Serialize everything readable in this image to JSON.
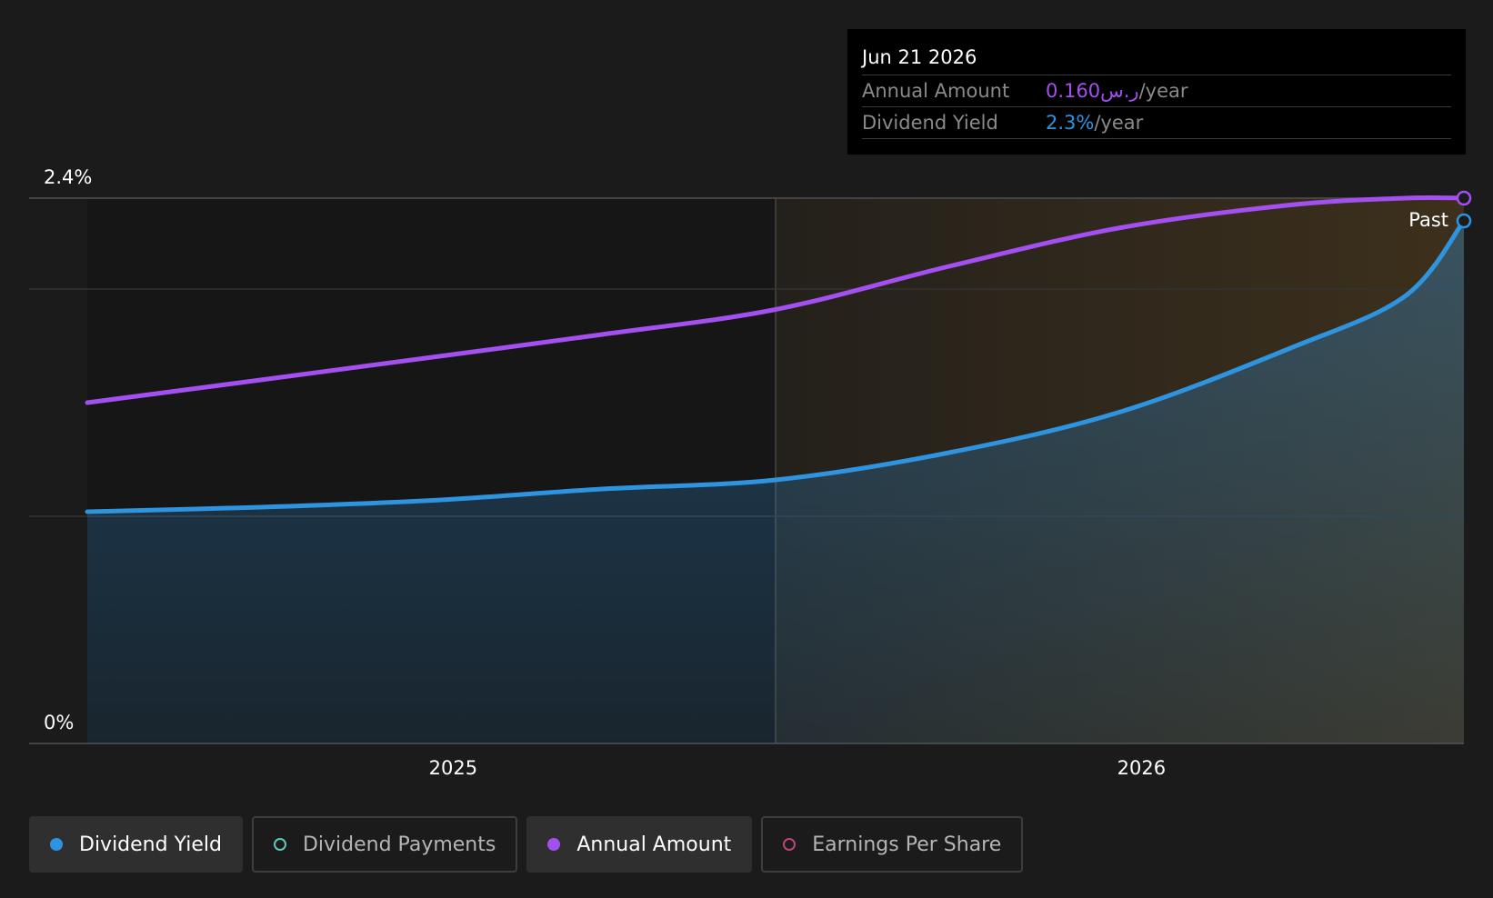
{
  "tooltip": {
    "date": "Jun 21 2026",
    "rows": [
      {
        "label": "Annual Amount",
        "value": "0.160ر.س",
        "suffix": "/year",
        "color": "#a44ff0"
      },
      {
        "label": "Dividend Yield",
        "value": "2.3%",
        "suffix": "/year",
        "color": "#2f94e0"
      }
    ]
  },
  "past_label": "Past",
  "legend": [
    {
      "label": "Dividend Yield",
      "active": true,
      "color": "#2f94e0",
      "filled": true
    },
    {
      "label": "Dividend Payments",
      "active": false,
      "color": "#5fc7bd",
      "filled": false
    },
    {
      "label": "Annual Amount",
      "active": true,
      "color": "#a44ff0",
      "filled": true
    },
    {
      "label": "Earnings Per Share",
      "active": false,
      "color": "#c0427a",
      "filled": false
    }
  ],
  "colors": {
    "background": "#1b1b1b",
    "yield": "#2f94e0",
    "annual": "#a44ff0",
    "forecast_tint": "#f0a020"
  },
  "chart_data": {
    "type": "line",
    "y_ticks": [
      "2.4%",
      "0%"
    ],
    "ylim": [
      0,
      2.4
    ],
    "y_unit": "%",
    "x_ticks": [
      "2025",
      "2026"
    ],
    "xlim": [
      "2024-06-21",
      "2026-06-21"
    ],
    "past_region_start": "2025-06-21",
    "grid": true,
    "series": [
      {
        "name": "Dividend Yield",
        "x": [
          "2024-06-21",
          "2024-09-21",
          "2024-12-21",
          "2025-03-21",
          "2025-06-21",
          "2025-09-21",
          "2025-12-21",
          "2026-03-21",
          "2026-05-21",
          "2026-06-21"
        ],
        "values": [
          1.02,
          1.04,
          1.07,
          1.12,
          1.16,
          1.28,
          1.46,
          1.74,
          1.97,
          2.3
        ]
      },
      {
        "name": "Annual Amount",
        "x": [
          "2024-06-21",
          "2024-09-21",
          "2024-12-21",
          "2025-03-21",
          "2025-06-21",
          "2025-09-21",
          "2025-12-21",
          "2026-03-21",
          "2026-05-21",
          "2026-06-21"
        ],
        "values": [
          1.5,
          1.6,
          1.7,
          1.8,
          1.91,
          2.1,
          2.27,
          2.37,
          2.4,
          2.4
        ]
      }
    ]
  }
}
